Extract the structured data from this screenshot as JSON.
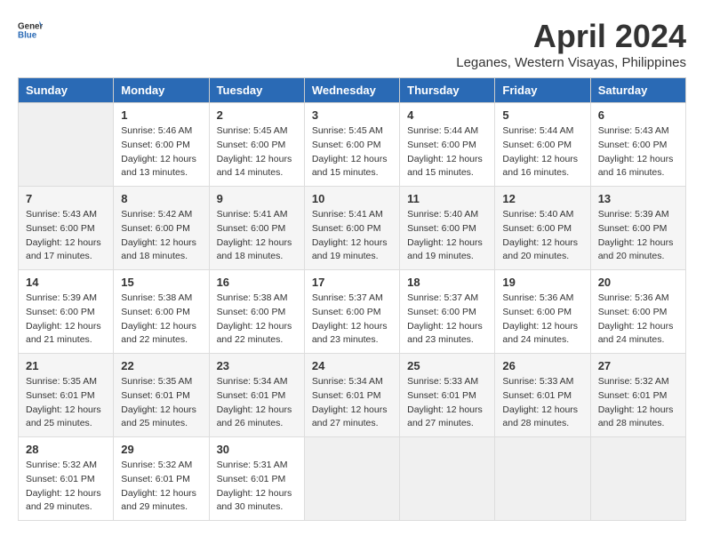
{
  "logo": {
    "general": "General",
    "blue": "Blue"
  },
  "title": "April 2024",
  "location": "Leganes, Western Visayas, Philippines",
  "weekdays": [
    "Sunday",
    "Monday",
    "Tuesday",
    "Wednesday",
    "Thursday",
    "Friday",
    "Saturday"
  ],
  "weeks": [
    [
      {
        "day": "",
        "info": ""
      },
      {
        "day": "1",
        "info": "Sunrise: 5:46 AM\nSunset: 6:00 PM\nDaylight: 12 hours\nand 13 minutes."
      },
      {
        "day": "2",
        "info": "Sunrise: 5:45 AM\nSunset: 6:00 PM\nDaylight: 12 hours\nand 14 minutes."
      },
      {
        "day": "3",
        "info": "Sunrise: 5:45 AM\nSunset: 6:00 PM\nDaylight: 12 hours\nand 15 minutes."
      },
      {
        "day": "4",
        "info": "Sunrise: 5:44 AM\nSunset: 6:00 PM\nDaylight: 12 hours\nand 15 minutes."
      },
      {
        "day": "5",
        "info": "Sunrise: 5:44 AM\nSunset: 6:00 PM\nDaylight: 12 hours\nand 16 minutes."
      },
      {
        "day": "6",
        "info": "Sunrise: 5:43 AM\nSunset: 6:00 PM\nDaylight: 12 hours\nand 16 minutes."
      }
    ],
    [
      {
        "day": "7",
        "info": "Sunrise: 5:43 AM\nSunset: 6:00 PM\nDaylight: 12 hours\nand 17 minutes."
      },
      {
        "day": "8",
        "info": "Sunrise: 5:42 AM\nSunset: 6:00 PM\nDaylight: 12 hours\nand 18 minutes."
      },
      {
        "day": "9",
        "info": "Sunrise: 5:41 AM\nSunset: 6:00 PM\nDaylight: 12 hours\nand 18 minutes."
      },
      {
        "day": "10",
        "info": "Sunrise: 5:41 AM\nSunset: 6:00 PM\nDaylight: 12 hours\nand 19 minutes."
      },
      {
        "day": "11",
        "info": "Sunrise: 5:40 AM\nSunset: 6:00 PM\nDaylight: 12 hours\nand 19 minutes."
      },
      {
        "day": "12",
        "info": "Sunrise: 5:40 AM\nSunset: 6:00 PM\nDaylight: 12 hours\nand 20 minutes."
      },
      {
        "day": "13",
        "info": "Sunrise: 5:39 AM\nSunset: 6:00 PM\nDaylight: 12 hours\nand 20 minutes."
      }
    ],
    [
      {
        "day": "14",
        "info": "Sunrise: 5:39 AM\nSunset: 6:00 PM\nDaylight: 12 hours\nand 21 minutes."
      },
      {
        "day": "15",
        "info": "Sunrise: 5:38 AM\nSunset: 6:00 PM\nDaylight: 12 hours\nand 22 minutes."
      },
      {
        "day": "16",
        "info": "Sunrise: 5:38 AM\nSunset: 6:00 PM\nDaylight: 12 hours\nand 22 minutes."
      },
      {
        "day": "17",
        "info": "Sunrise: 5:37 AM\nSunset: 6:00 PM\nDaylight: 12 hours\nand 23 minutes."
      },
      {
        "day": "18",
        "info": "Sunrise: 5:37 AM\nSunset: 6:00 PM\nDaylight: 12 hours\nand 23 minutes."
      },
      {
        "day": "19",
        "info": "Sunrise: 5:36 AM\nSunset: 6:00 PM\nDaylight: 12 hours\nand 24 minutes."
      },
      {
        "day": "20",
        "info": "Sunrise: 5:36 AM\nSunset: 6:00 PM\nDaylight: 12 hours\nand 24 minutes."
      }
    ],
    [
      {
        "day": "21",
        "info": "Sunrise: 5:35 AM\nSunset: 6:01 PM\nDaylight: 12 hours\nand 25 minutes."
      },
      {
        "day": "22",
        "info": "Sunrise: 5:35 AM\nSunset: 6:01 PM\nDaylight: 12 hours\nand 25 minutes."
      },
      {
        "day": "23",
        "info": "Sunrise: 5:34 AM\nSunset: 6:01 PM\nDaylight: 12 hours\nand 26 minutes."
      },
      {
        "day": "24",
        "info": "Sunrise: 5:34 AM\nSunset: 6:01 PM\nDaylight: 12 hours\nand 27 minutes."
      },
      {
        "day": "25",
        "info": "Sunrise: 5:33 AM\nSunset: 6:01 PM\nDaylight: 12 hours\nand 27 minutes."
      },
      {
        "day": "26",
        "info": "Sunrise: 5:33 AM\nSunset: 6:01 PM\nDaylight: 12 hours\nand 28 minutes."
      },
      {
        "day": "27",
        "info": "Sunrise: 5:32 AM\nSunset: 6:01 PM\nDaylight: 12 hours\nand 28 minutes."
      }
    ],
    [
      {
        "day": "28",
        "info": "Sunrise: 5:32 AM\nSunset: 6:01 PM\nDaylight: 12 hours\nand 29 minutes."
      },
      {
        "day": "29",
        "info": "Sunrise: 5:32 AM\nSunset: 6:01 PM\nDaylight: 12 hours\nand 29 minutes."
      },
      {
        "day": "30",
        "info": "Sunrise: 5:31 AM\nSunset: 6:01 PM\nDaylight: 12 hours\nand 30 minutes."
      },
      {
        "day": "",
        "info": ""
      },
      {
        "day": "",
        "info": ""
      },
      {
        "day": "",
        "info": ""
      },
      {
        "day": "",
        "info": ""
      }
    ]
  ]
}
